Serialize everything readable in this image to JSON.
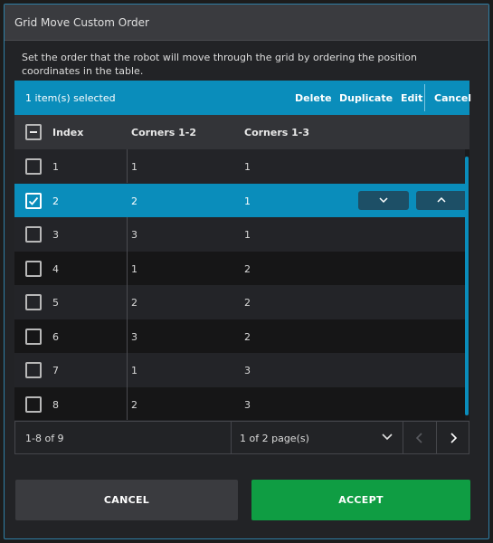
{
  "dialog": {
    "title": "Grid Move Custom Order",
    "description": "Set the order that the robot will move through the grid by ordering the position coordinates in the table."
  },
  "selection_bar": {
    "count_text": "1 item(s) selected",
    "delete_label": "Delete",
    "duplicate_label": "Duplicate",
    "edit_label": "Edit",
    "cancel_label": "Cancel"
  },
  "table": {
    "columns": [
      "Index",
      "Corners 1-2",
      "Corners 1-3"
    ],
    "rows": [
      {
        "index": "1",
        "c12": "1",
        "c13": "1",
        "checked": false
      },
      {
        "index": "2",
        "c12": "2",
        "c13": "1",
        "checked": true
      },
      {
        "index": "3",
        "c12": "3",
        "c13": "1",
        "checked": false
      },
      {
        "index": "4",
        "c12": "1",
        "c13": "2",
        "checked": false
      },
      {
        "index": "5",
        "c12": "2",
        "c13": "2",
        "checked": false
      },
      {
        "index": "6",
        "c12": "3",
        "c13": "2",
        "checked": false
      },
      {
        "index": "7",
        "c12": "1",
        "c13": "3",
        "checked": false
      },
      {
        "index": "8",
        "c12": "2",
        "c13": "3",
        "checked": false
      }
    ],
    "selected_row_actions": [
      "chevron-down-icon",
      "chevron-up-icon"
    ]
  },
  "pagination": {
    "range_text": "1-8 of 9",
    "pages_text": "1 of 2 page(s)"
  },
  "footer": {
    "cancel_label": "CANCEL",
    "accept_label": "ACCEPT"
  },
  "colors": {
    "accent": "#0a8dbb",
    "accept": "#0f9d43",
    "background": "#222326"
  }
}
